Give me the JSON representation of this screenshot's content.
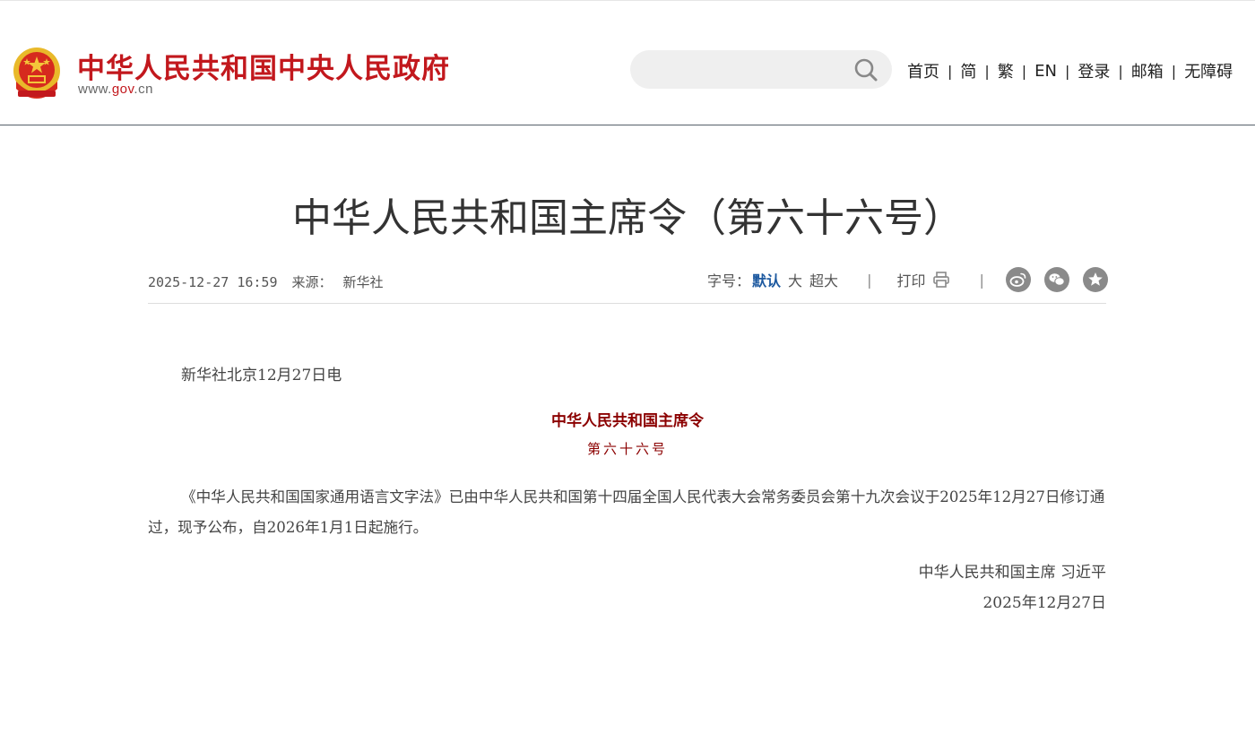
{
  "header": {
    "site_name": "中华人民共和国中央人民政府",
    "url_prefix": "www.",
    "url_highlight": "gov",
    "url_suffix": ".cn",
    "search_placeholder": "",
    "nav": {
      "home": "首页",
      "simplified": "简",
      "traditional": "繁",
      "english": "EN",
      "login": "登录",
      "mail": "邮箱",
      "accessibility": "无障碍"
    },
    "nav_separator": "|"
  },
  "article": {
    "title": "中华人民共和国主席令（第六十六号）",
    "date": "2025-12-27 16:59",
    "source_label": "来源：",
    "source": "新华社",
    "font_size_label": "字号：",
    "font_size_default": "默认",
    "font_size_large": "大",
    "font_size_xlarge": "超大",
    "separator": "|",
    "print_label": "打印",
    "dateline": "新华社北京12月27日电",
    "order_heading": "中华人民共和国主席令",
    "order_number": "第六十六号",
    "paragraph": "《中华人民共和国国家通用语言文字法》已由中华人民共和国第十四届全国人民代表大会常务委员会第十九次会议于2025年12月27日修订通过，现予公布，自2026年1月1日起施行。",
    "signature": "中华人民共和国主席 习近平",
    "sign_date": "2025年12月27日"
  },
  "icons": {
    "emblem": "national-emblem-icon",
    "search": "search-icon",
    "print": "printer-icon",
    "weibo": "weibo-icon",
    "wechat": "wechat-icon",
    "favorite": "star-icon"
  },
  "colors": {
    "brand_red": "#c2181d",
    "order_red": "#8b0000",
    "active_blue": "#1e5aa0",
    "share_gray": "#8a8a8a"
  }
}
